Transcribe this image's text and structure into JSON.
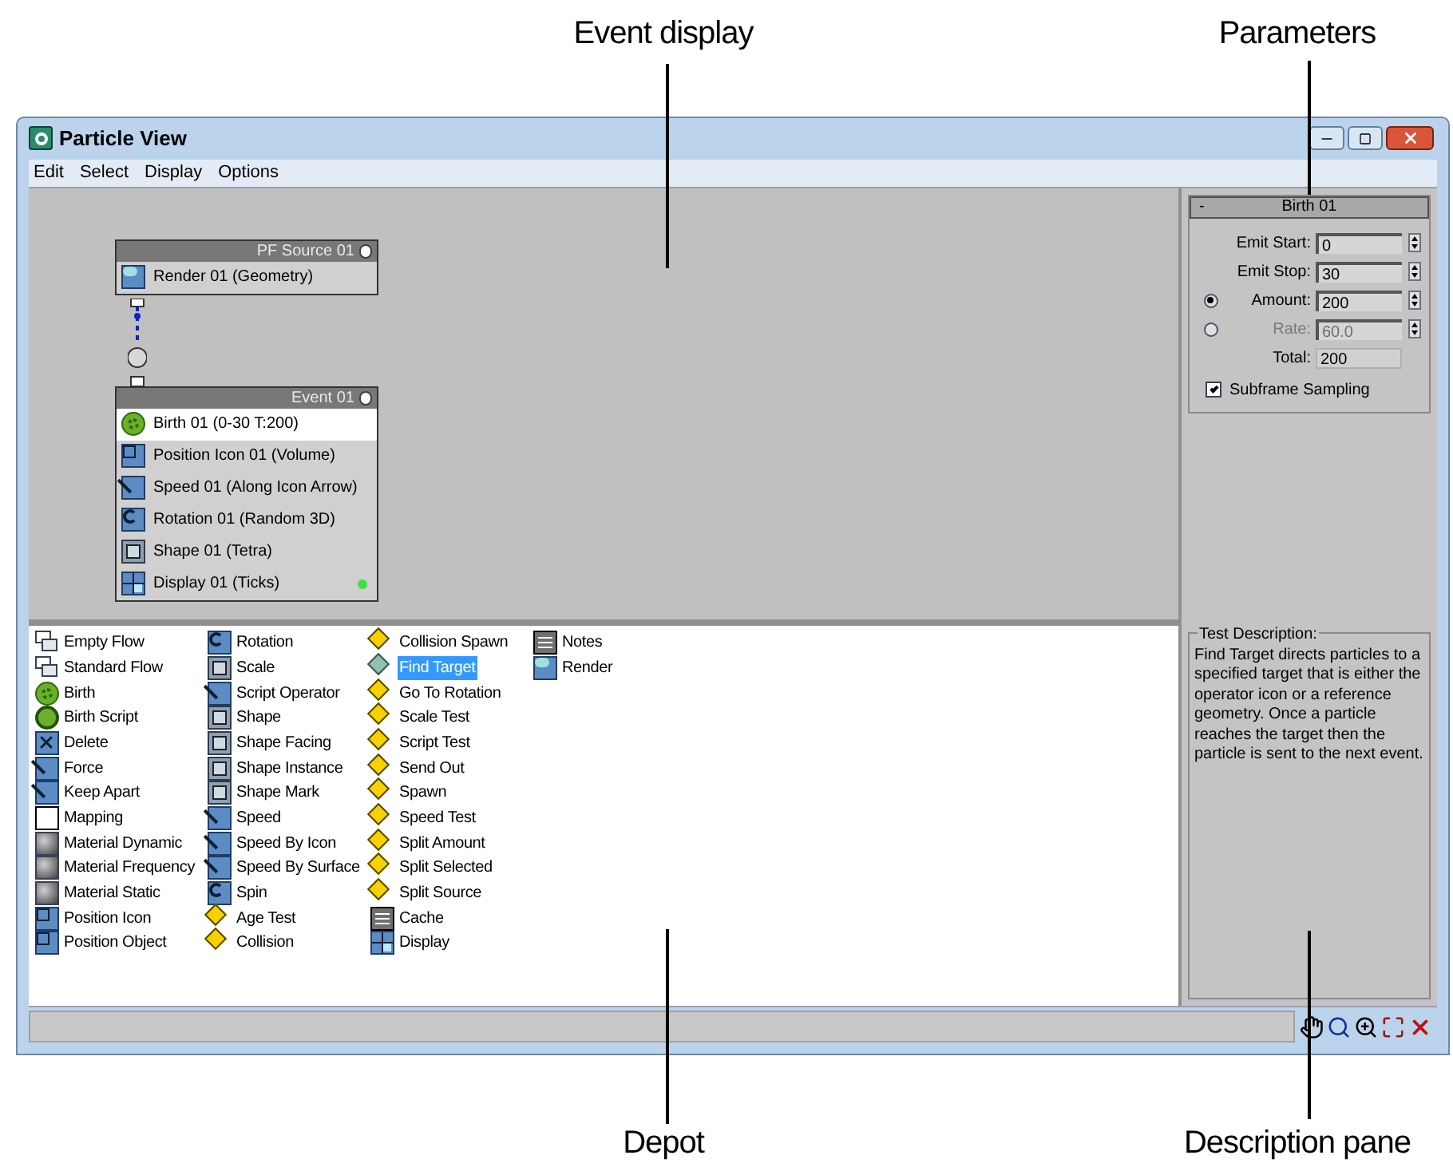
{
  "callouts": {
    "top": [
      "Event display",
      "Parameters"
    ],
    "bottom": [
      "Depot",
      "Description pane"
    ]
  },
  "window": {
    "title": "Particle View"
  },
  "menu": [
    "Edit",
    "Select",
    "Display",
    "Options"
  ],
  "event_display": {
    "nodes": [
      {
        "title": "PF Source 01",
        "items": [
          {
            "label": "Render 01 (Geometry)",
            "kind": "render",
            "selected": false,
            "indicator": false
          }
        ]
      },
      {
        "title": "Event 01",
        "items": [
          {
            "label": "Birth 01 (0-30 T:200)",
            "kind": "birth",
            "selected": true,
            "indicator": false
          },
          {
            "label": "Position Icon 01 (Volume)",
            "kind": "position",
            "selected": false,
            "indicator": false
          },
          {
            "label": "Speed 01 (Along Icon Arrow)",
            "kind": "operator",
            "selected": false,
            "indicator": false
          },
          {
            "label": "Rotation 01 (Random 3D)",
            "kind": "rotation",
            "selected": false,
            "indicator": false
          },
          {
            "label": "Shape 01 (Tetra)",
            "kind": "shape",
            "selected": false,
            "indicator": false
          },
          {
            "label": "Display 01 (Ticks)",
            "kind": "display",
            "selected": false,
            "indicator": true
          }
        ]
      }
    ]
  },
  "parameters": {
    "collapse": "-",
    "title": "Birth 01",
    "fields": [
      {
        "kind": "spinner",
        "label": "Emit Start:",
        "value": "0",
        "disabled": false
      },
      {
        "kind": "spinner",
        "label": "Emit Stop:",
        "value": "30",
        "disabled": false
      },
      {
        "kind": "radio",
        "label": "Amount:",
        "value": "200",
        "disabled": false,
        "selected": true
      },
      {
        "kind": "radio",
        "label": "Rate:",
        "value": "60.0",
        "disabled": true,
        "selected": false
      },
      {
        "kind": "readout",
        "label": "Total:",
        "value": "200",
        "disabled": false
      }
    ],
    "checkbox": {
      "label": "Subframe Sampling",
      "checked": true
    }
  },
  "depot": {
    "columns": [
      [
        {
          "label": "Empty Flow",
          "kind": "flow",
          "selected": false
        },
        {
          "label": "Standard Flow",
          "kind": "flow",
          "selected": false
        },
        {
          "label": "Birth",
          "kind": "birth",
          "selected": false
        },
        {
          "label": "Birth Script",
          "kind": "script",
          "selected": false
        },
        {
          "label": "Delete",
          "kind": "delete",
          "selected": false
        },
        {
          "label": "Force",
          "kind": "operator",
          "selected": false
        },
        {
          "label": "Keep Apart",
          "kind": "operator",
          "selected": false
        },
        {
          "label": "Mapping",
          "kind": "mapping",
          "selected": false
        },
        {
          "label": "Material Dynamic",
          "kind": "material",
          "selected": false
        },
        {
          "label": "Material Frequency",
          "kind": "material",
          "selected": false
        },
        {
          "label": "Material Static",
          "kind": "material",
          "selected": false
        },
        {
          "label": "Position Icon",
          "kind": "position",
          "selected": false
        },
        {
          "label": "Position Object",
          "kind": "position",
          "selected": false
        }
      ],
      [
        {
          "label": "Rotation",
          "kind": "rotation",
          "selected": false
        },
        {
          "label": "Scale",
          "kind": "shape",
          "selected": false
        },
        {
          "label": "Script Operator",
          "kind": "operator",
          "selected": false
        },
        {
          "label": "Shape",
          "kind": "shape",
          "selected": false
        },
        {
          "label": "Shape Facing",
          "kind": "shape",
          "selected": false
        },
        {
          "label": "Shape Instance",
          "kind": "shape",
          "selected": false
        },
        {
          "label": "Shape Mark",
          "kind": "shape",
          "selected": false
        },
        {
          "label": "Speed",
          "kind": "operator",
          "selected": false
        },
        {
          "label": "Speed By Icon",
          "kind": "operator",
          "selected": false
        },
        {
          "label": "Speed By Surface",
          "kind": "operator",
          "selected": false
        },
        {
          "label": "Spin",
          "kind": "rotation",
          "selected": false
        },
        {
          "label": "Age Test",
          "kind": "test",
          "selected": false
        },
        {
          "label": "Collision",
          "kind": "test",
          "selected": false
        }
      ],
      [
        {
          "label": "Collision Spawn",
          "kind": "test",
          "selected": false
        },
        {
          "label": "Find Target",
          "kind": "target",
          "selected": true
        },
        {
          "label": "Go To Rotation",
          "kind": "test",
          "selected": false
        },
        {
          "label": "Scale Test",
          "kind": "test",
          "selected": false
        },
        {
          "label": "Script Test",
          "kind": "test",
          "selected": false
        },
        {
          "label": "Send Out",
          "kind": "test",
          "selected": false
        },
        {
          "label": "Spawn",
          "kind": "test",
          "selected": false
        },
        {
          "label": "Speed Test",
          "kind": "test",
          "selected": false
        },
        {
          "label": "Split Amount",
          "kind": "test",
          "selected": false
        },
        {
          "label": "Split Selected",
          "kind": "test",
          "selected": false
        },
        {
          "label": "Split Source",
          "kind": "test",
          "selected": false
        },
        {
          "label": "Cache",
          "kind": "utility",
          "selected": false
        },
        {
          "label": "Display",
          "kind": "display",
          "selected": false
        }
      ],
      [
        {
          "label": "Notes",
          "kind": "utility",
          "selected": false
        },
        {
          "label": "Render",
          "kind": "render",
          "selected": false
        }
      ]
    ]
  },
  "description": {
    "title": "Test Description:",
    "text": "Find Target directs particles to a specified target that is either the operator icon or a reference geometry. Once a particle reaches the target then the particle is sent to the next event."
  }
}
